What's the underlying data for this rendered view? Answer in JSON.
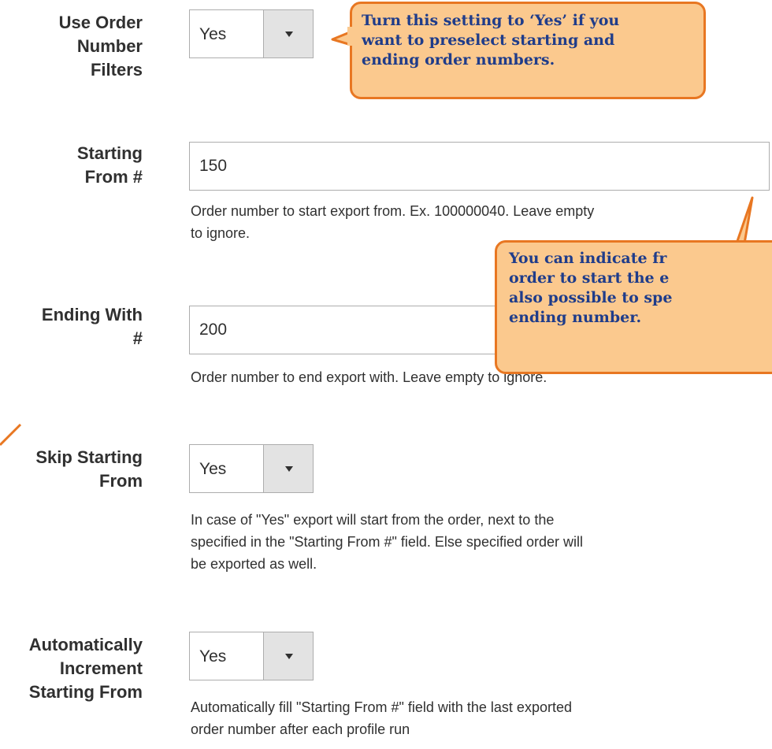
{
  "fields": {
    "use_order_number_filters": {
      "label_lines": [
        "Use Order",
        "Number",
        "Filters"
      ],
      "value": "Yes"
    },
    "starting_from": {
      "label_lines": [
        "Starting",
        "From #"
      ],
      "value": "150",
      "note_lines": [
        "Order number to start export from. Ex. 100000040. Leave empty",
        "to ignore."
      ]
    },
    "ending_with": {
      "label_lines": [
        "Ending With",
        "#"
      ],
      "value": "200",
      "note": "Order number to end export with. Leave empty to ignore."
    },
    "skip_starting_from": {
      "label_lines": [
        "Skip Starting",
        "From"
      ],
      "value": "Yes",
      "note_lines": [
        "In case of \"Yes\" export will start from the order, next to the",
        "specified in the \"Starting From #\" field. Else specified order will",
        "be exported as well."
      ]
    },
    "auto_increment": {
      "label_lines": [
        "Automatically",
        "Increment",
        "Starting From"
      ],
      "value": "Yes",
      "note_lines": [
        "Automatically fill \"Starting From #\" field with the last exported",
        "order number after each profile run"
      ]
    }
  },
  "callouts": {
    "top": {
      "lines": [
        "Turn this setting to ‘Yes’  if you",
        "want to preselect starting and",
        "ending order numbers."
      ]
    },
    "right": {
      "lines": [
        "You can indicate fr",
        "order to start the e",
        "also possible to spe",
        "ending number."
      ]
    }
  },
  "colors": {
    "callout_fill": "#fbc98e",
    "callout_border": "#e87722",
    "callout_text": "#1f3c8a"
  }
}
